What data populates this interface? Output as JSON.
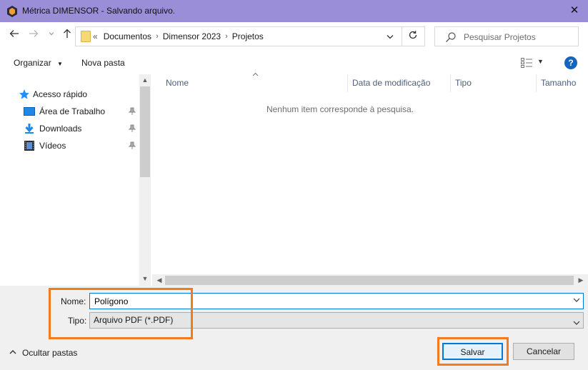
{
  "window": {
    "title": "Métrica DIMENSOR - Salvando arquivo.",
    "close_symbol": "✕"
  },
  "address": {
    "overflow": "«",
    "breadcrumbs": [
      "Documentos",
      "Dimensor 2023",
      "Projetos"
    ],
    "separator": "›"
  },
  "search": {
    "placeholder": "Pesquisar Projetos"
  },
  "toolbar": {
    "organize_label": "Organizar",
    "new_folder_label": "Nova pasta"
  },
  "nav": {
    "items": [
      {
        "label": "Acesso rápido",
        "icon": "star-icon"
      },
      {
        "label": "Área de Trabalho",
        "icon": "desktop-icon",
        "pinned": true
      },
      {
        "label": "Downloads",
        "icon": "download-icon",
        "pinned": true
      },
      {
        "label": "Vídeos",
        "icon": "video-icon",
        "pinned": true
      }
    ]
  },
  "filelist": {
    "columns": [
      "Nome",
      "Data de modificação",
      "Tipo",
      "Tamanho"
    ],
    "empty_message": "Nenhum item corresponde à pesquisa."
  },
  "form": {
    "name_label": "Nome:",
    "name_value": "Polígono",
    "type_label": "Tipo:",
    "type_value": "Arquivo PDF (*.PDF)"
  },
  "footer": {
    "hide_folders_label": "Ocultar pastas",
    "save_label": "Salvar",
    "cancel_label": "Cancelar"
  },
  "colors": {
    "titlebar": "#9a8ed9",
    "highlight": "#f47a20",
    "accent": "#0078d7"
  }
}
